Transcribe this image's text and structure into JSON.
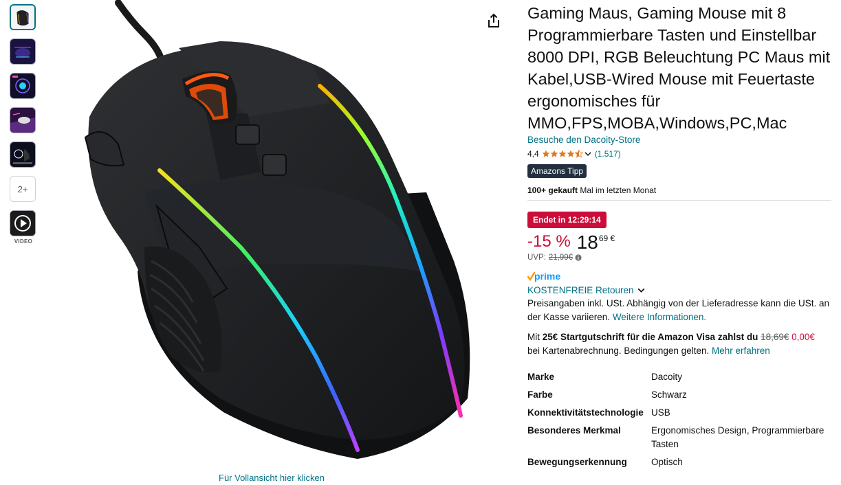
{
  "gallery": {
    "more_label": "2+",
    "video_label": "VIDEO",
    "fullview_link": "Für Vollansicht hier klicken"
  },
  "product": {
    "title": "Gaming Maus, Gaming Mouse mit 8 Programmierbare Tasten und Einstellbar 8000 DPI, RGB Beleuchtung PC Maus mit Kabel,USB-Wired Mouse mit Feuertaste ergonomisches für MMO,FPS,MOBA,Windows,PC,Mac",
    "store_link": "Besuche den Dacoity-Store",
    "rating": "4,4",
    "rating_stars": 4.4,
    "rating_count": "(1.517)",
    "badge": "Amazons Tipp",
    "bought_bold": "100+ gekauft",
    "bought_rest": " Mal im letzten Monat"
  },
  "price": {
    "deal_badge": "Endet in 12:29:14",
    "discount": "-15 %",
    "whole": "18",
    "fraction": "69 €",
    "uvp_label": "UVP:",
    "uvp_value": "21,99€"
  },
  "delivery": {
    "returns_link": "KOSTENFREIE Retouren",
    "tax_text": "Preisangaben inkl. USt. Abhängig von der Lieferadresse kann die USt. an der Kasse variieren. ",
    "tax_link": "Weitere Informationen."
  },
  "visa": {
    "prefix": "Mit ",
    "bold": "25€ Startgutschrift für die Amazon Visa zahlst du",
    "old_price": "18,69€",
    "new_price": "0,00€",
    "suffix": "bei Kartenabrechnung. Bedingungen gelten. ",
    "link": "Mehr erfahren"
  },
  "specs": [
    {
      "key": "Marke",
      "value": "Dacoity"
    },
    {
      "key": "Farbe",
      "value": "Schwarz"
    },
    {
      "key": "Konnektivitätstechnologie",
      "value": "USB"
    },
    {
      "key": "Besonderes Merkmal",
      "value": "Ergonomisches Design, Programmierbare Tasten"
    },
    {
      "key": "Bewegungserkennung",
      "value": "Optisch"
    }
  ],
  "colors": {
    "link": "#007185",
    "deal_red": "#cc0c39",
    "star": "#de7921",
    "badge_dark": "#232f3e",
    "prime_blue": "#1399ff"
  },
  "icons": {
    "share": "share-icon",
    "info": "info-icon",
    "chevron": "chevron-down-icon",
    "play": "play-icon"
  }
}
